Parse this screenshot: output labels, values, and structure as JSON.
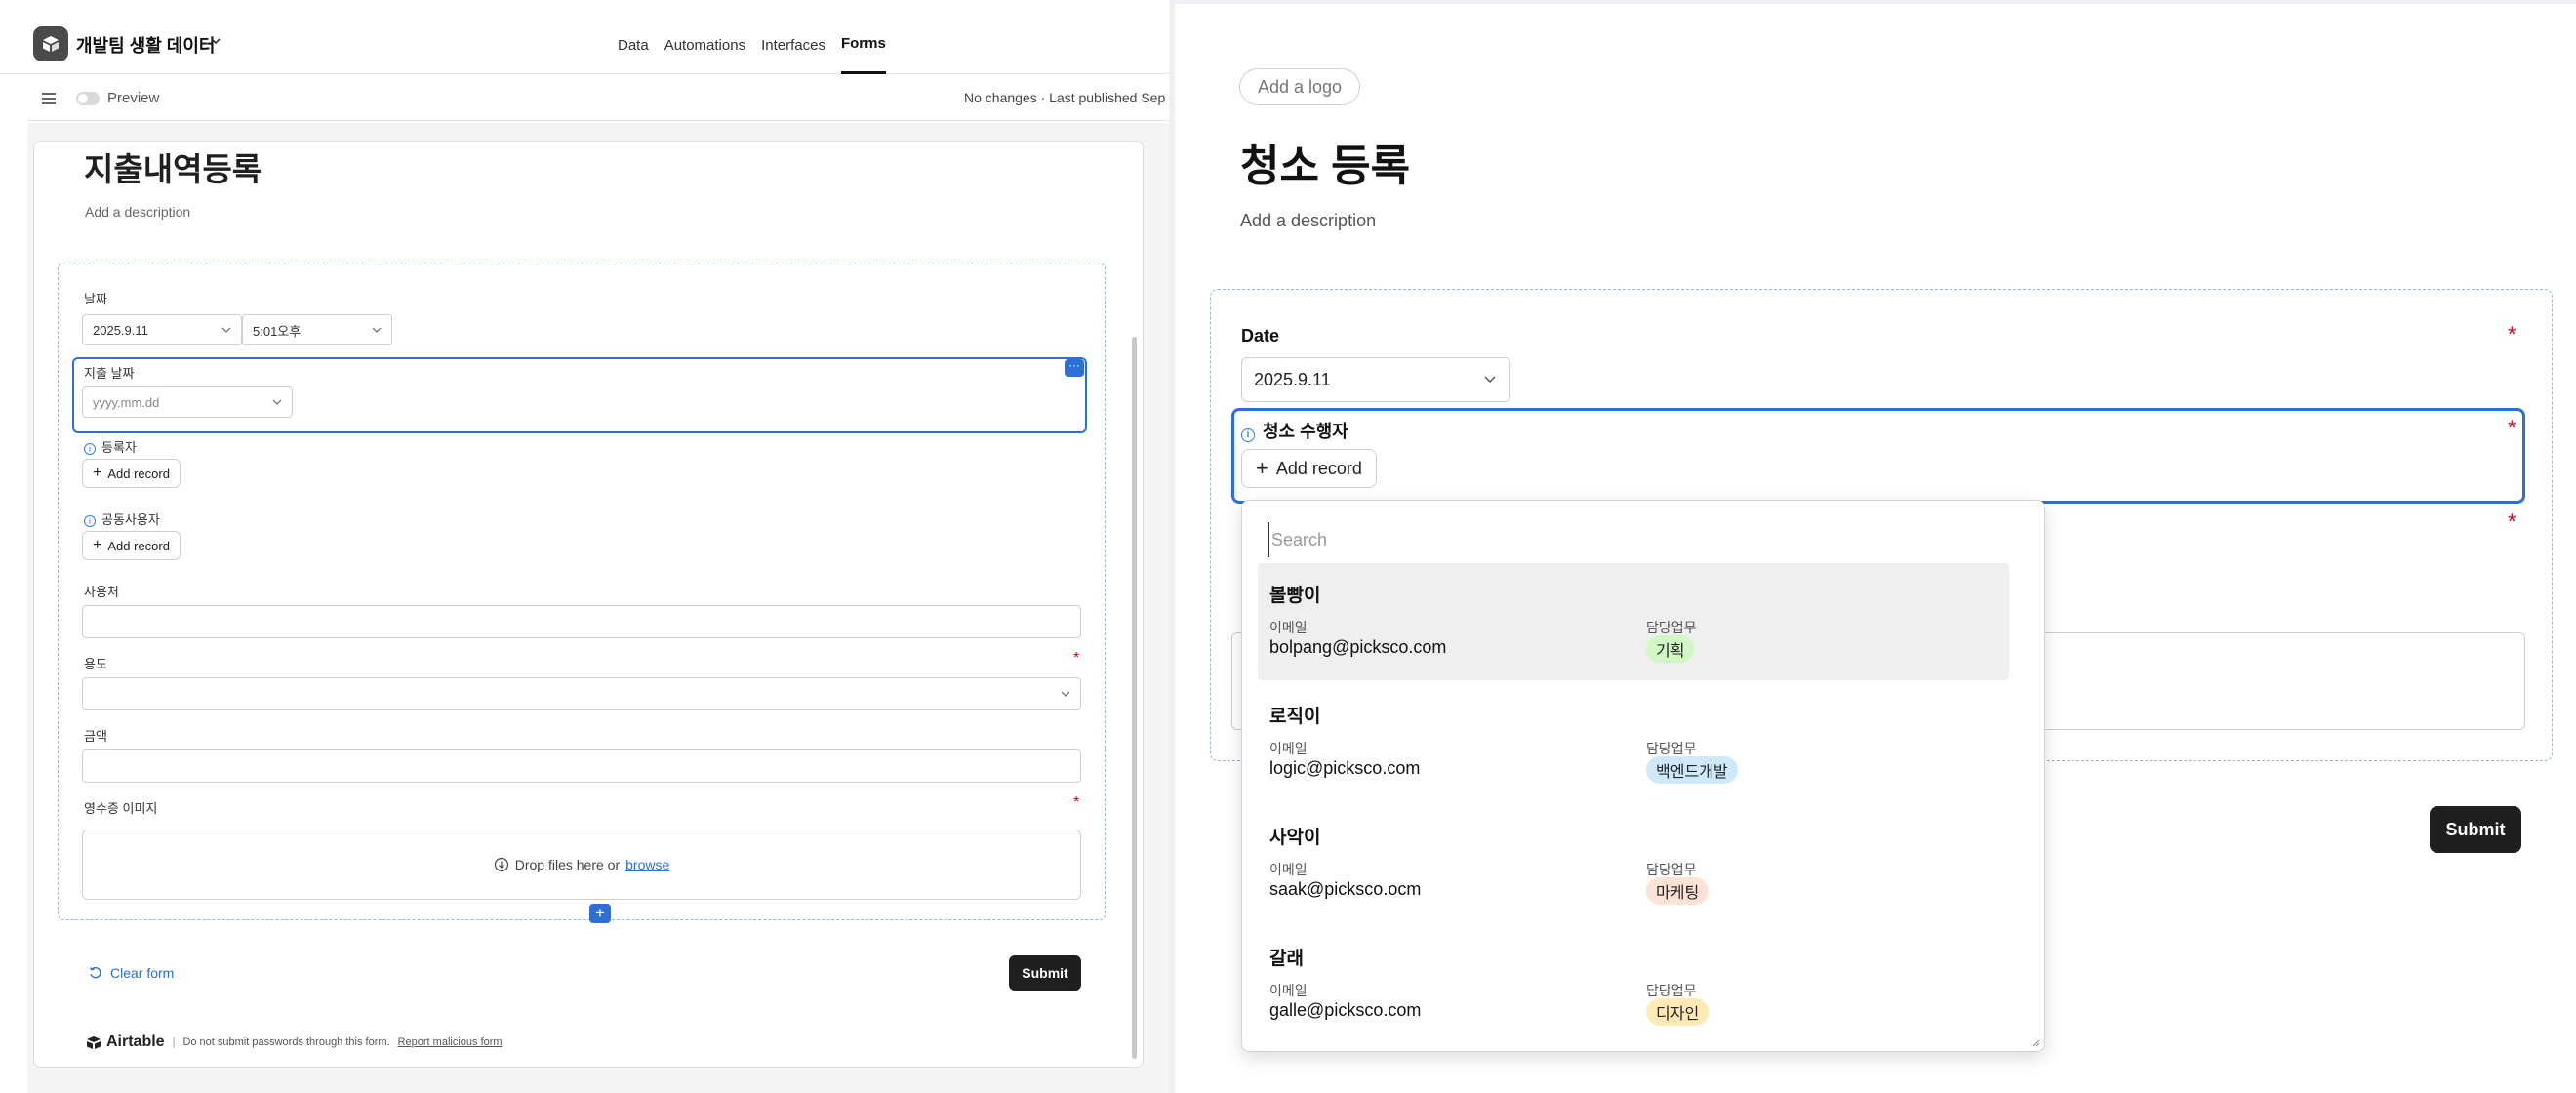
{
  "builder": {
    "base_name": "개발팀 생활 데이터",
    "nav_tabs": [
      {
        "label": "Data",
        "active": false
      },
      {
        "label": "Automations",
        "active": false
      },
      {
        "label": "Interfaces",
        "active": false
      },
      {
        "label": "Forms",
        "active": true
      }
    ],
    "preview_label": "Preview",
    "status_text": "No changes · Last published Sep",
    "form": {
      "title": "지출내역등록",
      "description_placeholder": "Add a description",
      "fields": {
        "date": {
          "label": "날짜",
          "date_value": "2025.9.11",
          "time_value": "5:01오후"
        },
        "spend_date": {
          "label": "지출 날짜",
          "placeholder": "yyyy.mm.dd"
        },
        "registrant": {
          "label": "등록자",
          "button": "Add record"
        },
        "co_user": {
          "label": "공동사용자",
          "button": "Add record"
        },
        "merchant": {
          "label": "사용처"
        },
        "purpose": {
          "label": "용도",
          "required_mark": "*"
        },
        "amount": {
          "label": "금액"
        },
        "receipt": {
          "label": "영수증 이미지",
          "required_mark": "*",
          "drop_text": "Drop files here or",
          "browse_text": "browse"
        }
      },
      "clear_label": "Clear form",
      "submit_label": "Submit",
      "more_icon_text": "···",
      "add_field_text": "+"
    },
    "footer": {
      "brand": "Airtable",
      "separator": "|",
      "notice": "Do not submit passwords through this form.",
      "report": "Report malicious form"
    }
  },
  "published": {
    "logo_button": "Add a logo",
    "title": "청소 등록",
    "description_placeholder": "Add a description",
    "date_label": "Date",
    "date_value": "2025.9.11",
    "required_mark": "*",
    "assignee_label": "청소 수행자",
    "add_record": "Add record",
    "submit_label": "Submit",
    "dropdown": {
      "search_placeholder": "Search",
      "email_key": "이메일",
      "role_key": "담당업무",
      "items": [
        {
          "name": "볼빵이",
          "email": "bolpang@picksco.com",
          "role": "기획",
          "tag_color": "#d1f7c4",
          "highlight": true
        },
        {
          "name": "로직이",
          "email": "logic@picksco.com",
          "role": "백엔드개발",
          "tag_color": "#cfe9fb",
          "highlight": false
        },
        {
          "name": "사악이",
          "email": "saak@picksco.ocm",
          "role": "마케팅",
          "tag_color": "#fee2d5",
          "highlight": false
        },
        {
          "name": "갈래",
          "email": "galle@picksco.com",
          "role": "디자인",
          "tag_color": "#ffeab6",
          "highlight": false
        }
      ]
    }
  },
  "colors": {
    "accent": "#2d6fd6",
    "required": "#d0021b",
    "dark_button": "#1f1f1f"
  }
}
